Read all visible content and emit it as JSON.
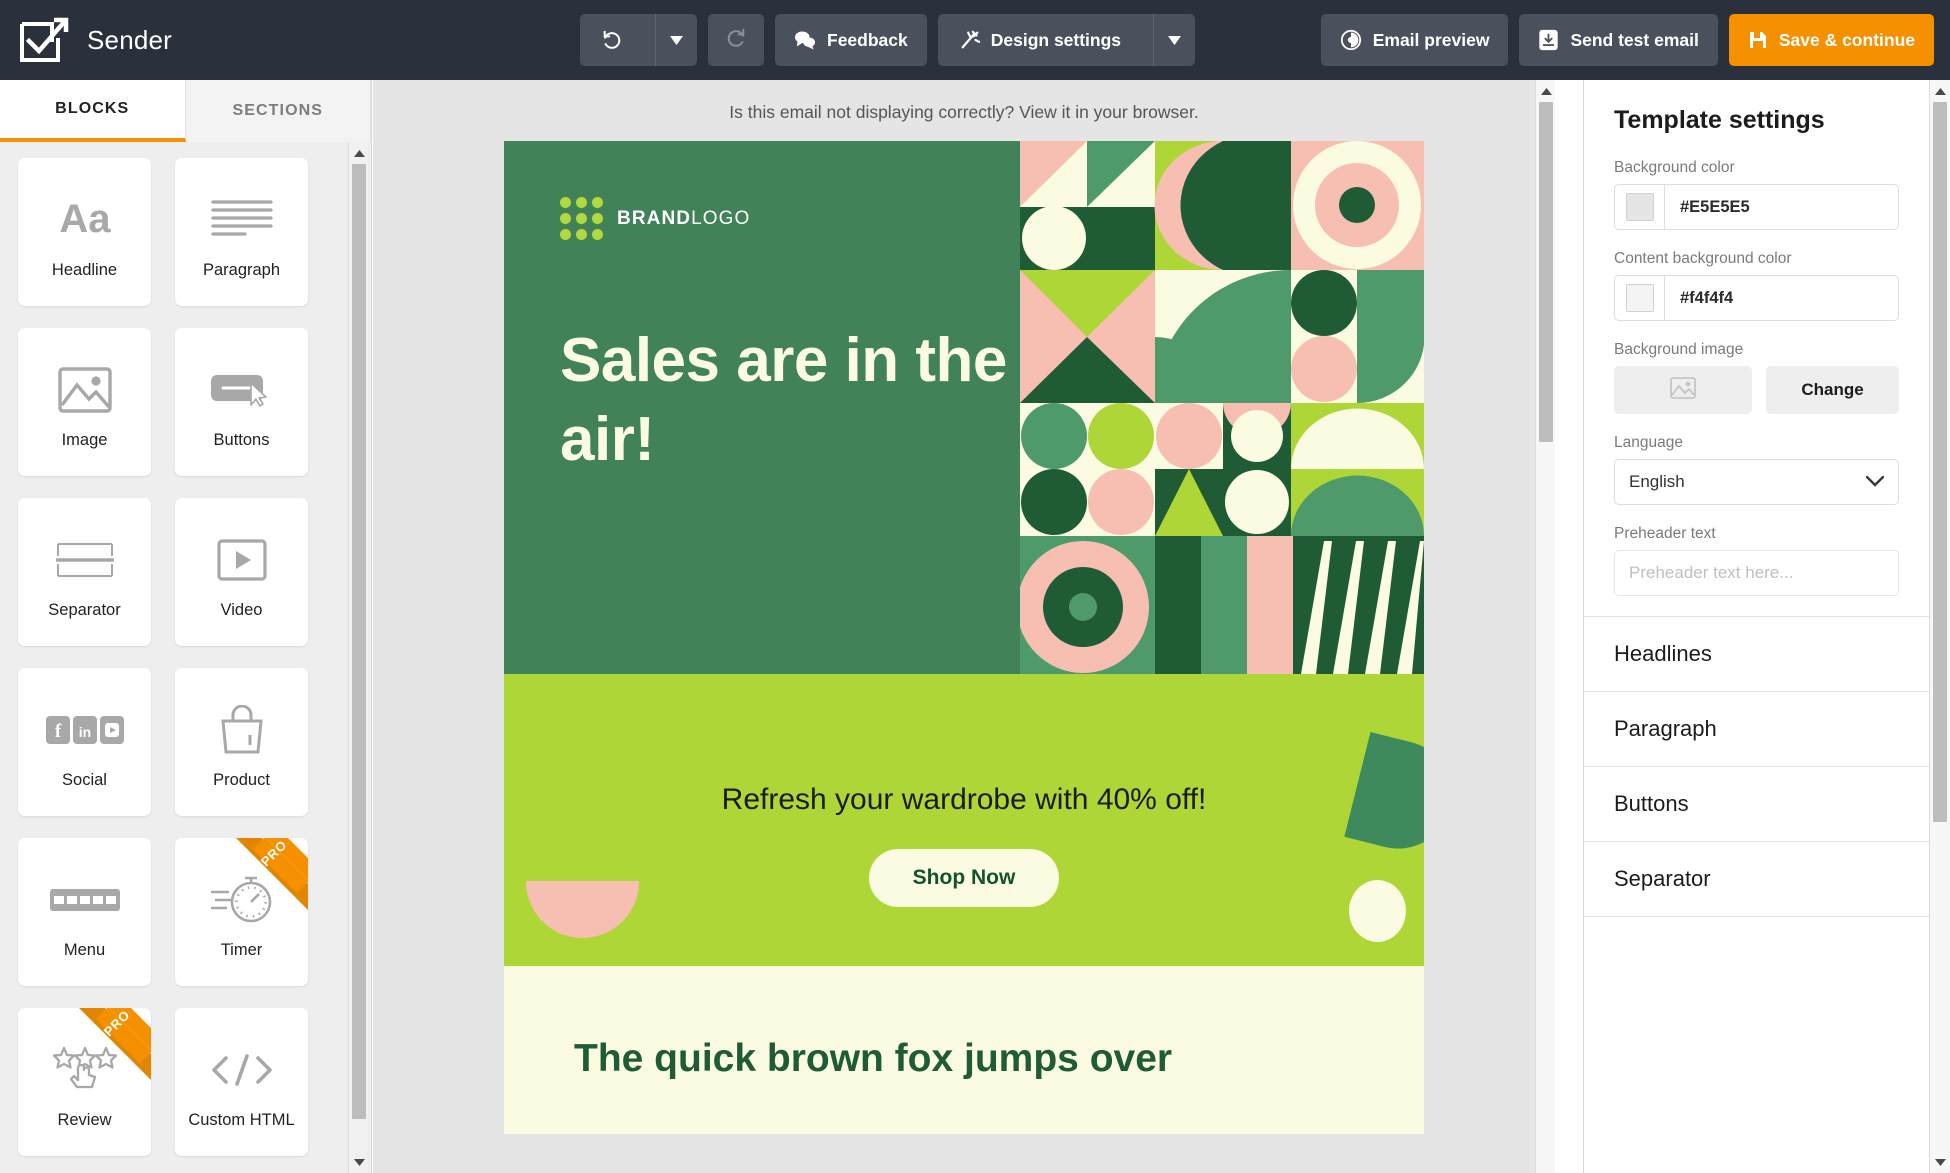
{
  "app": {
    "name": "Sender",
    "logo_icon": "checkbox-arrow-logo-icon"
  },
  "toolbar": {
    "undo": {
      "label": "",
      "icon": "undo-icon",
      "caret_icon": "chevron-down-icon"
    },
    "redo": {
      "label": "",
      "icon": "redo-icon",
      "disabled": true
    },
    "feedback": {
      "label": "Feedback",
      "icon": "chat-bubble-icon"
    },
    "design_settings": {
      "label": "Design settings",
      "icon": "magic-wand-icon",
      "caret_icon": "chevron-down-icon"
    },
    "email_preview": {
      "label": "Email preview",
      "icon": "eye-icon"
    },
    "send_test_email": {
      "label": "Send test email",
      "icon": "inbox-arrow-icon"
    },
    "save_continue": {
      "label": "Save & continue",
      "icon": "save-disk-icon"
    },
    "accent_color": "#f59100"
  },
  "sidebar": {
    "tabs": [
      {
        "label": "BLOCKS",
        "active": true
      },
      {
        "label": "SECTIONS",
        "active": false
      }
    ],
    "blocks": [
      {
        "label": "Headline",
        "icon": "text-aa-icon",
        "pro": false
      },
      {
        "label": "Paragraph",
        "icon": "paragraph-lines-icon",
        "pro": false
      },
      {
        "label": "Image",
        "icon": "image-icon",
        "pro": false
      },
      {
        "label": "Buttons",
        "icon": "button-cursor-icon",
        "pro": false
      },
      {
        "label": "Separator",
        "icon": "separator-icon",
        "pro": false
      },
      {
        "label": "Video",
        "icon": "video-play-icon",
        "pro": false
      },
      {
        "label": "Social",
        "icon": "social-networks-icon",
        "pro": false
      },
      {
        "label": "Product",
        "icon": "shopping-bag-icon",
        "pro": false
      },
      {
        "label": "Menu",
        "icon": "menu-bar-icon",
        "pro": false
      },
      {
        "label": "Timer",
        "icon": "stopwatch-icon",
        "pro": true
      },
      {
        "label": "Review",
        "icon": "star-rating-hand-icon",
        "pro": true
      },
      {
        "label": "Custom HTML",
        "icon": "code-brackets-icon",
        "pro": false
      }
    ],
    "pro_badge": "PRO"
  },
  "canvas": {
    "view_in_browser_note": "Is this email not displaying correctly? View it in your browser.",
    "background_color": "#e5e5e5",
    "email": {
      "brand_logo": {
        "text_bold": "BRAND",
        "text_light": "LOGO",
        "dot_color": "#b5d93f"
      },
      "hero": {
        "headline": "Sales are in the air!",
        "background_color": "#418259",
        "text_color": "#fafbe0"
      },
      "promo": {
        "headline": "Refresh your wardrobe with 40% off!",
        "button_label": "Shop Now",
        "background_color": "#aed636"
      },
      "body": {
        "headline": "The quick brown fox jumps over",
        "background_color": "#fafbe0",
        "text_color": "#1f5b35"
      },
      "palette": {
        "dark_green": "#1f5b35",
        "mid_green": "#418259",
        "light_green": "#4f9a6b",
        "lime": "#aed636",
        "pink": "#f7bfb1",
        "cream": "#fafbe0"
      }
    }
  },
  "right_panel": {
    "title": "Template settings",
    "fields": {
      "background_color": {
        "label": "Background color",
        "value": "#E5E5E5"
      },
      "content_background_color": {
        "label": "Content background color",
        "value": "#f4f4f4"
      },
      "background_image": {
        "label": "Background image",
        "change_label": "Change",
        "icon": "image-placeholder-icon"
      },
      "language": {
        "label": "Language",
        "value": "English",
        "caret_icon": "chevron-down-icon"
      },
      "preheader_text": {
        "label": "Preheader text",
        "value": "",
        "placeholder": "Preheader text here..."
      }
    },
    "accordion": [
      {
        "label": "Headlines"
      },
      {
        "label": "Paragraph"
      },
      {
        "label": "Buttons"
      },
      {
        "label": "Separator"
      }
    ]
  }
}
